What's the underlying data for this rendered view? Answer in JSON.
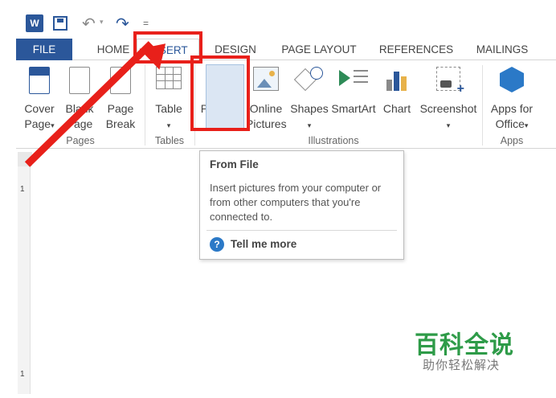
{
  "title_bar": {
    "app_icon": "word-icon",
    "app_icon_letter": "W",
    "more_glyph": "="
  },
  "tabs": [
    {
      "label": "FILE"
    },
    {
      "label": "HOME"
    },
    {
      "label": "INSERT"
    },
    {
      "label": "DESIGN"
    },
    {
      "label": "PAGE LAYOUT"
    },
    {
      "label": "REFERENCES"
    },
    {
      "label": "MAILINGS"
    }
  ],
  "active_tab": "INSERT",
  "ribbon": {
    "cover_page": {
      "line1": "Cover",
      "line2": "Page",
      "icon": "cover-page-icon"
    },
    "blank_page": {
      "line1": "Blank",
      "line2": "Page",
      "icon": "blank-page-icon"
    },
    "page_break": {
      "line1": "Page",
      "line2": "Break",
      "icon": "page-break-icon"
    },
    "table": {
      "line1": "Table",
      "icon": "table-icon"
    },
    "pictures": {
      "line1": "Pictures",
      "icon": "pictures-icon"
    },
    "online_pictures": {
      "line1": "Online",
      "line2": "Pictures",
      "icon": "online-pictures-icon"
    },
    "shapes": {
      "line1": "Shapes",
      "icon": "shapes-icon"
    },
    "smartart": {
      "line1": "SmartArt",
      "icon": "smartart-icon"
    },
    "chart": {
      "line1": "Chart",
      "icon": "chart-icon"
    },
    "screenshot": {
      "line1": "Screenshot",
      "icon": "screenshot-icon"
    },
    "apps": {
      "line1": "Apps for",
      "line2": "Office",
      "icon": "apps-icon"
    },
    "groups": {
      "pages": "Pages",
      "tables": "Tables",
      "illustrations": "Illustrations",
      "apps": "Apps"
    },
    "dropdown_glyph": "▾"
  },
  "tooltip": {
    "title": "From File",
    "description": "Insert pictures from your computer or from other computers that you're connected to.",
    "help_glyph": "?",
    "link": "Tell me more"
  },
  "ruler": {
    "marks": [
      "1",
      "1"
    ]
  },
  "watermark": {
    "line1": "百科全说",
    "line2": "助你轻松解决"
  },
  "colors": {
    "accent": "#2b579a",
    "annotation": "#e8201a",
    "watermark_green": "#2e9b48"
  }
}
